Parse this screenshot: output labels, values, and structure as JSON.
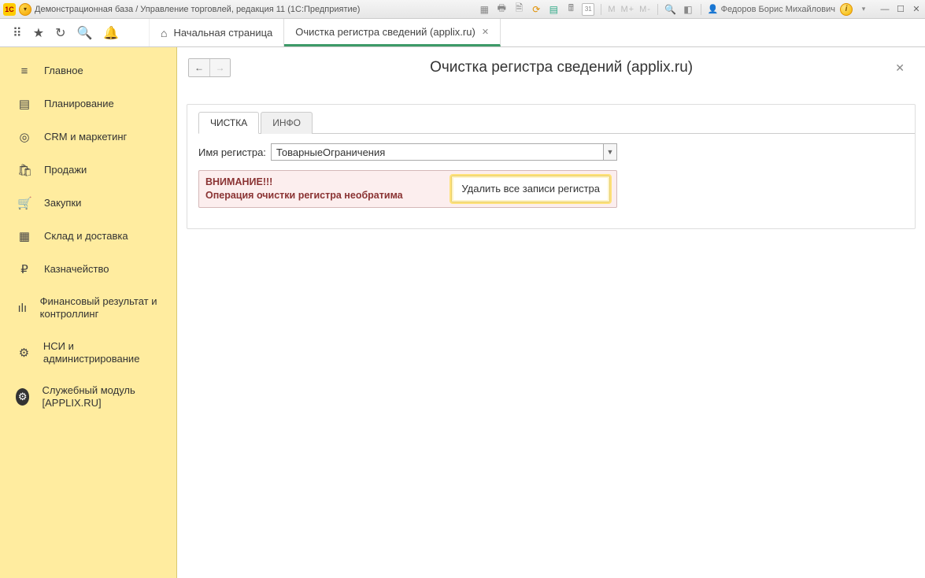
{
  "titlebar": {
    "app_title": "Демонстрационная база / Управление торговлей, редакция 11  (1С:Предприятие)",
    "user_name": "Федоров Борис Михайлович",
    "mem_labels": [
      "M",
      "M+",
      "M-"
    ]
  },
  "tabs": {
    "home_label": "Начальная страница",
    "active_label": "Очистка регистра сведений (applix.ru)"
  },
  "sidebar": {
    "items": [
      {
        "icon": "≡",
        "label": "Главное"
      },
      {
        "icon": "▤",
        "label": "Планирование"
      },
      {
        "icon": "◎",
        "label": "CRM и маркетинг"
      },
      {
        "icon": "🛍",
        "label": "Продажи"
      },
      {
        "icon": "🛒",
        "label": "Закупки"
      },
      {
        "icon": "▦",
        "label": "Склад и доставка"
      },
      {
        "icon": "₽",
        "label": "Казначейство"
      },
      {
        "icon": "ılı",
        "label": "Финансовый результат и контроллинг"
      },
      {
        "icon": "⚙",
        "label": "НСИ и администрирование"
      },
      {
        "icon": "⚙",
        "label": "Служебный модуль [APPLIX.RU]",
        "dark": true
      }
    ]
  },
  "page": {
    "title": "Очистка регистра сведений (applix.ru)",
    "inner_tabs": {
      "clean": "ЧИСТКА",
      "info": "ИНФО"
    },
    "register_label": "Имя регистра:",
    "register_value": "ТоварныеОграничения",
    "warning_line1": "ВНИМАНИЕ!!!",
    "warning_line2": "Операция очистки регистра необратима",
    "delete_button": "Удалить все записи регистра"
  }
}
